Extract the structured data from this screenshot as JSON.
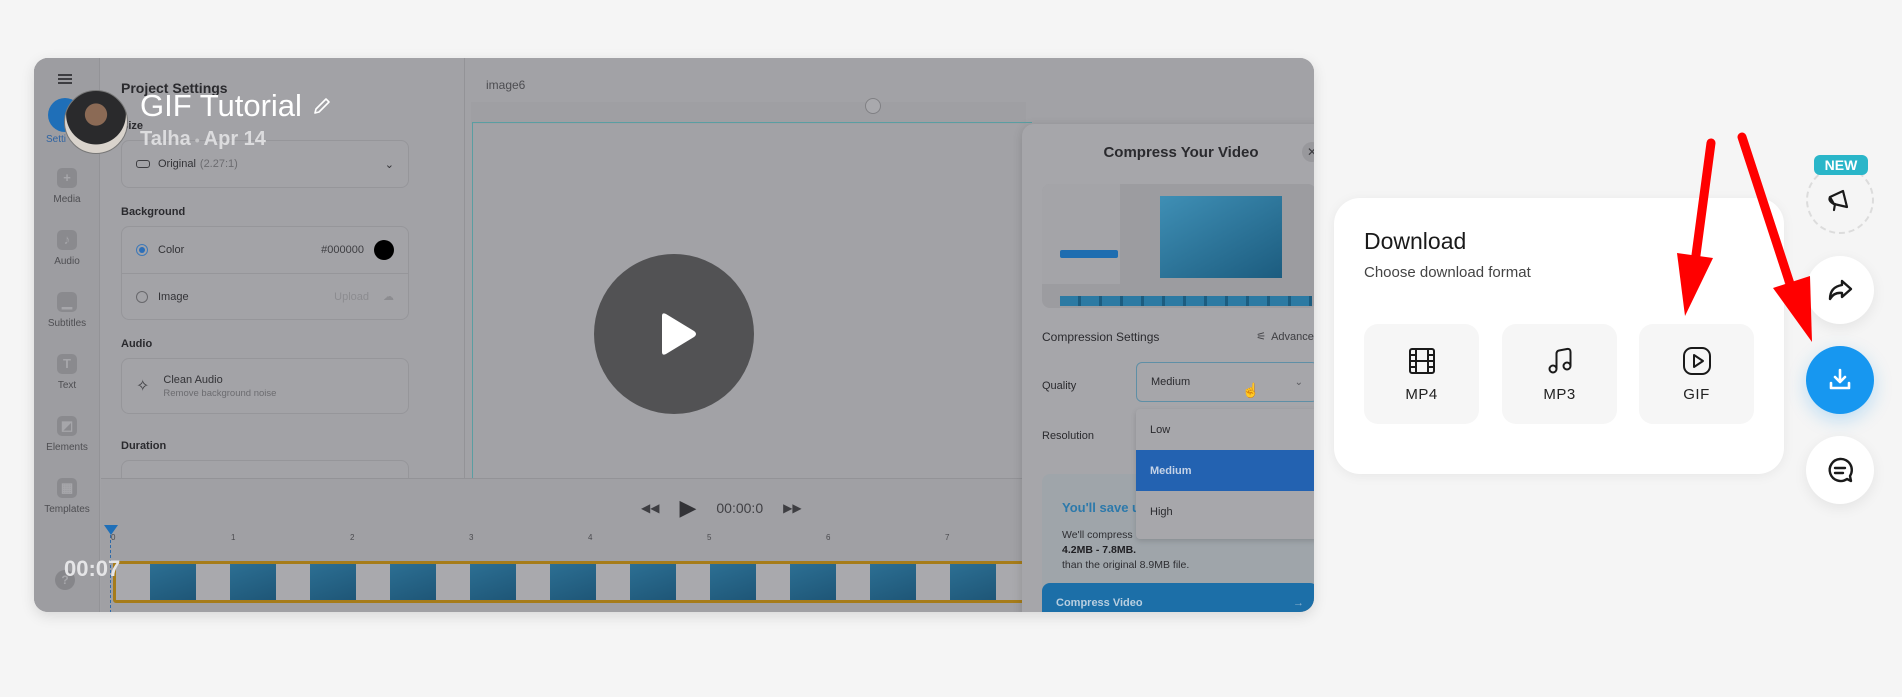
{
  "video": {
    "title": "GIF Tutorial",
    "author": "Talha",
    "date": "Apr 14",
    "separator": "•",
    "current_time": "00:07",
    "edit_icon": "pencil-icon",
    "avatar_icon": "user-avatar"
  },
  "editor": {
    "rail": {
      "menu_icon": "hamburger-icon",
      "settings_label": "Setti",
      "items": [
        {
          "label": "Media",
          "glyph": "+"
        },
        {
          "label": "Audio",
          "glyph": "♪"
        },
        {
          "label": "Subtitles",
          "glyph": "▁"
        },
        {
          "label": "Text",
          "glyph": "T"
        },
        {
          "label": "Elements",
          "glyph": "◩"
        },
        {
          "label": "Templates",
          "glyph": "▦"
        }
      ],
      "help_glyph": "?"
    },
    "settings": {
      "title": "Project Settings",
      "size_label": "Size",
      "size_value": "Original",
      "size_ratio": "(2.27:1)",
      "background_label": "Background",
      "color_option": "Color",
      "color_value": "#000000",
      "image_option": "Image",
      "upload_label": "Upload",
      "audio_label": "Audio",
      "clean_audio_title": "Clean Audio",
      "clean_audio_sub": "Remove background noise",
      "duration_label": "Duration"
    },
    "canvas": {
      "element_name": "image6"
    },
    "player": {
      "time": "00:00:0",
      "ticks": [
        "0",
        "1",
        "2",
        "3",
        "4",
        "5",
        "6",
        "7"
      ]
    }
  },
  "compress_modal": {
    "title": "Compress Your Video",
    "close_glyph": "✕",
    "settings_title": "Compression Settings",
    "advanced_label": "Advanced",
    "quality_label": "Quality",
    "quality_value": "Medium",
    "resolution_label": "Resolution",
    "quality_options": [
      "Low",
      "Medium",
      "High"
    ],
    "selected_option": "Medium",
    "save_title": "You'll save u",
    "save_line1": "We'll compress",
    "save_size_range": "4.2MB - 7.8MB.",
    "save_line3": "than the original 8.9MB file.",
    "compress_button": "Compress Video",
    "compress_arrow": "→"
  },
  "download": {
    "title": "Download",
    "subtitle": "Choose download format",
    "formats": [
      {
        "label": "MP4",
        "icon": "film-icon"
      },
      {
        "label": "MP3",
        "icon": "music-note-icon"
      },
      {
        "label": "GIF",
        "icon": "play-square-icon"
      }
    ]
  },
  "actions": {
    "new_badge": "NEW",
    "buttons": [
      {
        "name": "announcements",
        "icon": "megaphone-icon"
      },
      {
        "name": "share",
        "icon": "share-arrow-icon"
      },
      {
        "name": "download",
        "icon": "download-icon"
      },
      {
        "name": "comments",
        "icon": "chat-bubble-icon"
      }
    ]
  },
  "colors": {
    "accent_blue": "#1797f0",
    "badge_teal": "#2ab6c9",
    "annotation_red": "#ff0000",
    "dropdown_selected": "#2362b1",
    "compress_button": "#1c6fa8"
  }
}
